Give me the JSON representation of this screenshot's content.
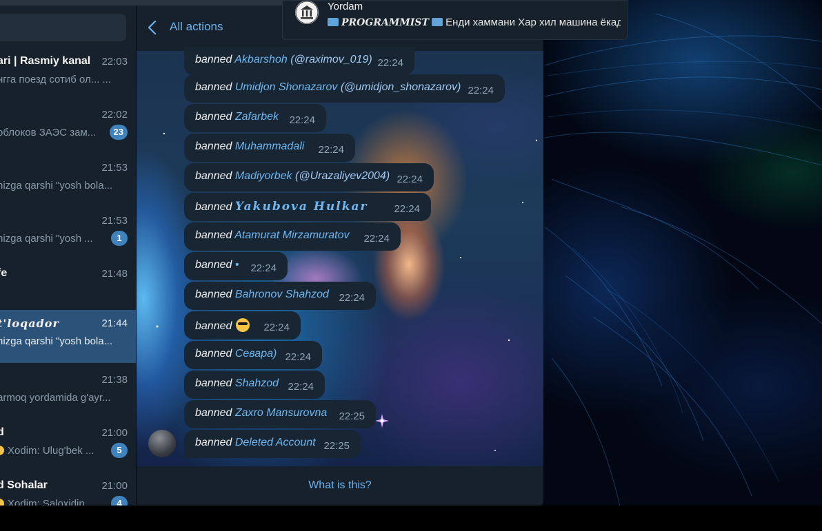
{
  "chat_list": [
    {
      "name": "ari | Rasmiy kanal",
      "time": "22:03",
      "preview": "нгга поезд сотиб ол... ..."
    },
    {
      "name": "",
      "time": "22:02",
      "preview": "облоков ЗАЭС зам...",
      "unread": "23"
    },
    {
      "name": "",
      "time": "21:53",
      "preview": "nizga qarshi \"yosh bola..."
    },
    {
      "name": "",
      "time": "21:53",
      "preview": "nizga qarshi \"yosh ...",
      "unread": "1"
    },
    {
      "name": "fe",
      "time": "21:48",
      "preview": ""
    },
    {
      "name": "t'loqador",
      "time": "21:44",
      "preview": "nizga qarshi \"yosh bola...",
      "active": true
    },
    {
      "name": "",
      "time": "21:38",
      "preview": "armoq yordamida g'ayr..."
    },
    {
      "name": "d",
      "time": "21:00",
      "preview": "Xodim: Ulug'bek ...",
      "unread": "5"
    },
    {
      "name": "d Sohalar",
      "time": "21:00",
      "preview": "Xodim: Saloxidin...",
      "unread": "4"
    }
  ],
  "header": {
    "title": "All actions"
  },
  "actions": [
    {
      "verb": "banned",
      "user": "Akbarshoh",
      "handle": "(@raximov_019)",
      "time": "22:24"
    },
    {
      "verb": "banned",
      "user": "Umidjon Shonazarov",
      "handle": "(@umidjon_shonazarov)",
      "time": "22:24"
    },
    {
      "verb": "banned",
      "user": "Zafarbek",
      "handle": "",
      "time": "22:24"
    },
    {
      "verb": "banned",
      "user": "Muhammadali",
      "handle": "",
      "time": "22:24"
    },
    {
      "verb": "banned",
      "user": "Madiyorbek",
      "handle": "(@Urazaliyev2004)",
      "time": "22:24"
    },
    {
      "verb": "banned",
      "user": "Yakubova Hulkar",
      "handle": "",
      "time": "22:24"
    },
    {
      "verb": "banned",
      "user": "Atamurat Mirzamuratov",
      "handle": "",
      "time": "22:24"
    },
    {
      "verb": "banned",
      "user": "•",
      "handle": "",
      "time": "22:24"
    },
    {
      "verb": "banned",
      "user": "Bahronov Shahzod",
      "handle": "",
      "time": "22:24"
    },
    {
      "verb": "banned",
      "user": "",
      "handle": "",
      "time": "22:24"
    },
    {
      "verb": "banned",
      "user": "Севарa)",
      "handle": "",
      "time": "22:24"
    },
    {
      "verb": "banned",
      "user": "Shahzod",
      "handle": "",
      "time": "22:24"
    },
    {
      "verb": "banned",
      "user": "Zaxro Mansurovna",
      "handle": "",
      "time": "22:25"
    },
    {
      "verb": "banned",
      "user": "Deleted Account",
      "handle": "",
      "time": "22:25"
    }
  ],
  "footer": {
    "link": "What is this?"
  },
  "notification": {
    "title": "Yordam",
    "sender": "PROGRAMMIST",
    "text": "Енди хаммани Хар хил машина ёкад..."
  },
  "colors": {
    "link": "#6cb2ef",
    "bubble": "#182533",
    "sidebar": "#17212b",
    "active": "#2b5278",
    "badge": "#4082bc"
  }
}
